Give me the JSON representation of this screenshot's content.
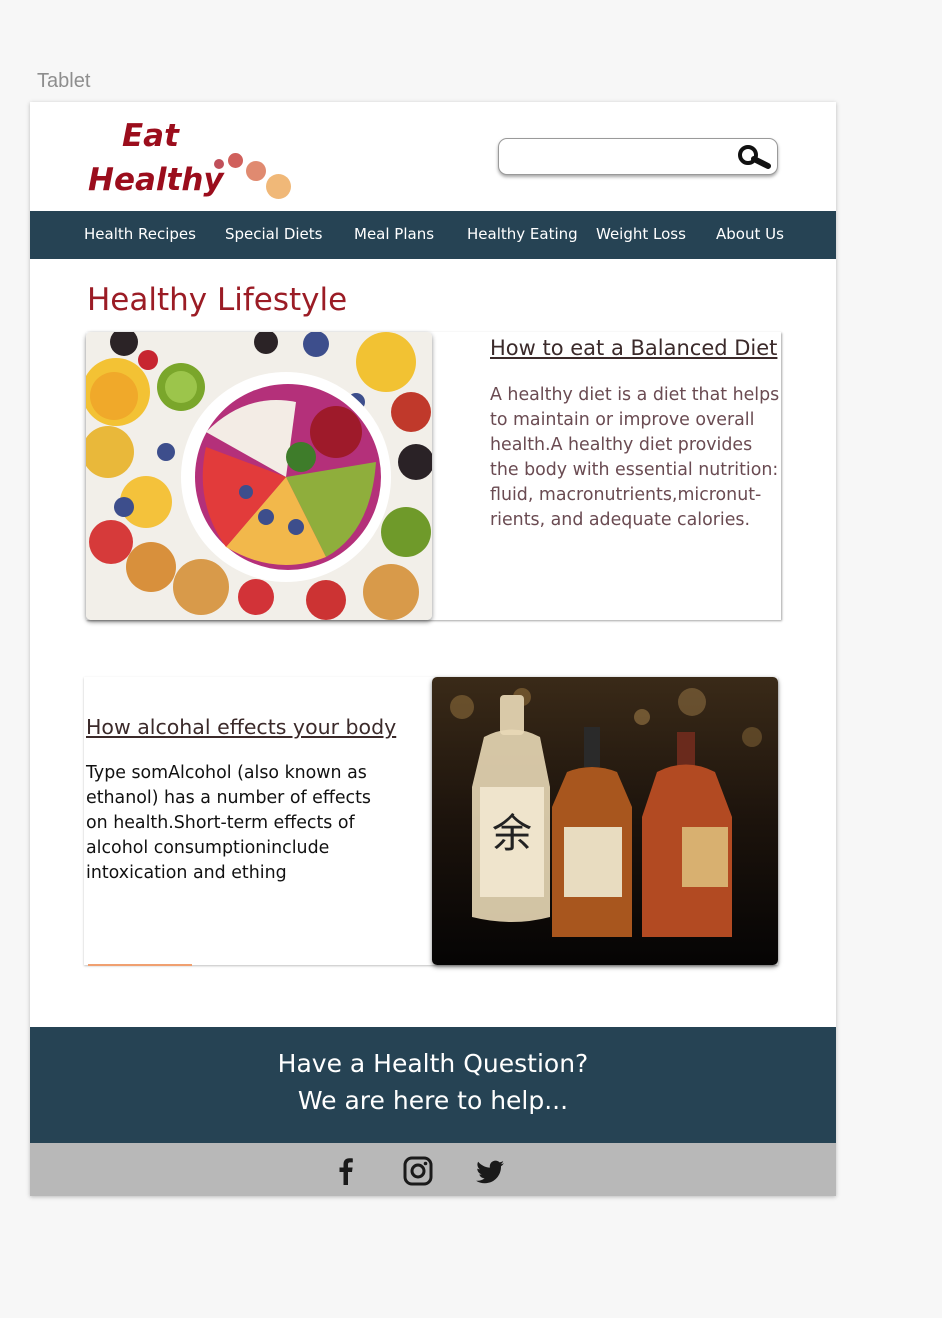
{
  "artboard_label": "Tablet",
  "brand": {
    "line1": "Eat",
    "line2": "Healthy",
    "colors": {
      "text": "#9b0d1c",
      "dot1": "#c0505a",
      "dot2": "#d77060",
      "dot3": "#e89a7a",
      "dot4": "#f0b878"
    }
  },
  "search": {
    "placeholder": "",
    "icon": "search-icon"
  },
  "nav": {
    "items": [
      {
        "label": "Health Recipes"
      },
      {
        "label": "Special Diets"
      },
      {
        "label": "Meal Plans"
      },
      {
        "label": "Healthy Eating"
      },
      {
        "label": "Weight Loss"
      },
      {
        "label": "About Us"
      }
    ],
    "background": "#264354"
  },
  "main": {
    "title": "Healthy Lifestyle",
    "articles": [
      {
        "heading": "How to eat a Balanced Diet",
        "body": "A healthy diet is a diet that helps to maintain or improve overall health.A healthy diet provides the body with essential nutrition: fluid, macronutrients,micronut-rients, and adequate calories.",
        "image": "fruit-bowl-photo"
      },
      {
        "heading": "How alcohal effects your body",
        "body": "Type somAlcohol (also known as ethanol) has a number of effects on health.Short-term effects of alcohol consumptioninclude intoxication and ething",
        "image": "whisky-bottles-photo"
      }
    ]
  },
  "footer": {
    "cta_line1": "Have a Health Question?",
    "cta_line2": "We are here to help...",
    "social": [
      "facebook-icon",
      "instagram-icon",
      "twitter-icon"
    ]
  }
}
